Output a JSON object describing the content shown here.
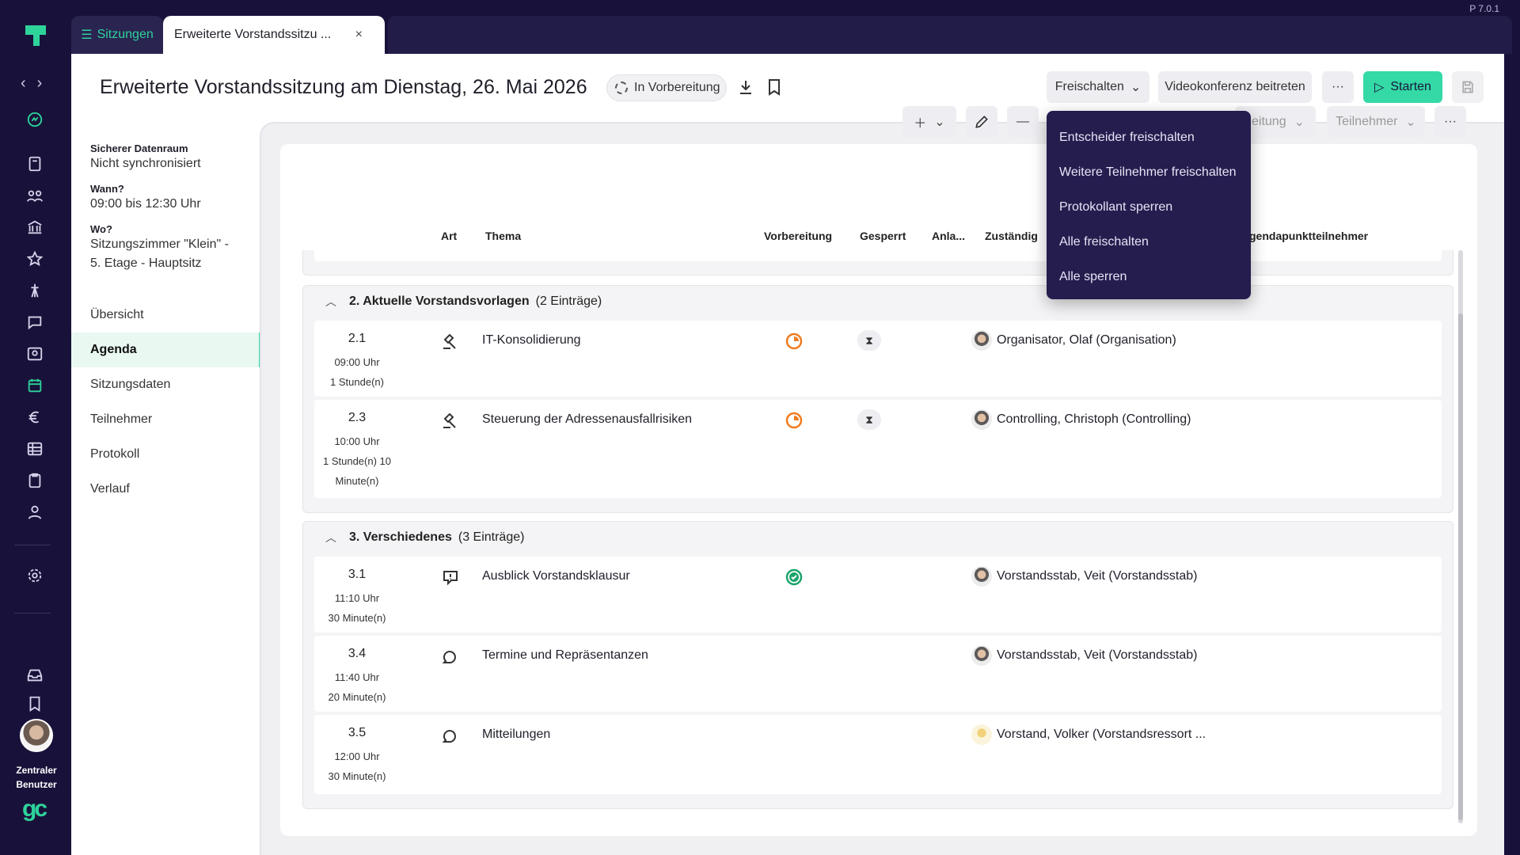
{
  "app": {
    "version": "P 7.0.1",
    "user_name": "Zentraler Benutzer",
    "brand": "gc"
  },
  "tabs": {
    "list_label": "Sitzungen",
    "active_label": "Erweiterte Vorstandssitzu ...",
    "close_symbol": "×"
  },
  "header": {
    "title": "Erweiterte Vorstandssitzung am Dienstag, 26. Mai 2026",
    "status": "In Vorbereitung",
    "freischalten": "Freischalten",
    "video": "Videokonferenz beitreten",
    "more": "···",
    "start": "Starten"
  },
  "dropdown": {
    "items": [
      "Entscheider freischalten",
      "Weitere Teilnehmer freischalten",
      "Protokollant sperren",
      "Alle freischalten",
      "Alle sperren"
    ]
  },
  "meta": {
    "room_label": "Sicherer Datenraum",
    "room_value": "Nicht synchronisiert",
    "when_label": "Wann?",
    "when_value": "09:00 bis 12:30 Uhr",
    "where_label": "Wo?",
    "where_line1": "Sitzungszimmer \"Klein\" -",
    "where_line2": "5. Etage - Hauptsitz"
  },
  "nav": {
    "items": [
      "Übersicht",
      "Agenda",
      "Sitzungsdaten",
      "Teilnehmer",
      "Protokoll",
      "Verlauf"
    ],
    "active": "Agenda"
  },
  "toolbar": {
    "vorbereitung_partial": "eitung",
    "teilnehmer": "Teilnehmer",
    "more": "···"
  },
  "columns": {
    "art": "Art",
    "thema": "Thema",
    "vorbereitung": "Vorbereitung",
    "gesperrt": "Gesperrt",
    "anlagen": "Anla...",
    "zustaendig": "Zuständig",
    "teilnehmer": "gendapunktteilnehmer"
  },
  "groups": [
    {
      "title": "2. Aktuelle Vorstandsvorlagen",
      "count": "(2 Einträge)",
      "rows": [
        {
          "num": "2.1",
          "time": "09:00 Uhr",
          "dur1": "1 Stunde(n)",
          "dur2": "",
          "topic": "IT-Konsolidierung",
          "person": "Organisator, Olaf (Organisation)"
        },
        {
          "num": "2.3",
          "time": "10:00 Uhr",
          "dur1": "1 Stunde(n) 10",
          "dur2": "Minute(n)",
          "topic": "Steuerung der Adressenausfallrisiken",
          "person": "Controlling, Christoph (Controlling)"
        }
      ]
    },
    {
      "title": "3. Verschiedenes",
      "count": "(3 Einträge)",
      "rows": [
        {
          "num": "3.1",
          "time": "11:10 Uhr",
          "dur1": "30 Minute(n)",
          "dur2": "",
          "topic": "Ausblick Vorstandsklausur",
          "person": "Vorstandsstab, Veit (Vorstandsstab)"
        },
        {
          "num": "3.4",
          "time": "11:40 Uhr",
          "dur1": "20 Minute(n)",
          "dur2": "",
          "topic": "Termine und Repräsentanzen",
          "person": "Vorstandsstab, Veit (Vorstandsstab)"
        },
        {
          "num": "3.5",
          "time": "12:00 Uhr",
          "dur1": "30 Minute(n)",
          "dur2": "",
          "topic": "Mitteilungen",
          "person": "Vorstand, Volker (Vorstandsressort ..."
        }
      ]
    }
  ],
  "colors": {
    "accent": "#34d9a6",
    "rail": "#18123a",
    "menu": "#251d4e",
    "in_progress": "#f07b1f",
    "done": "#1aa36a"
  }
}
